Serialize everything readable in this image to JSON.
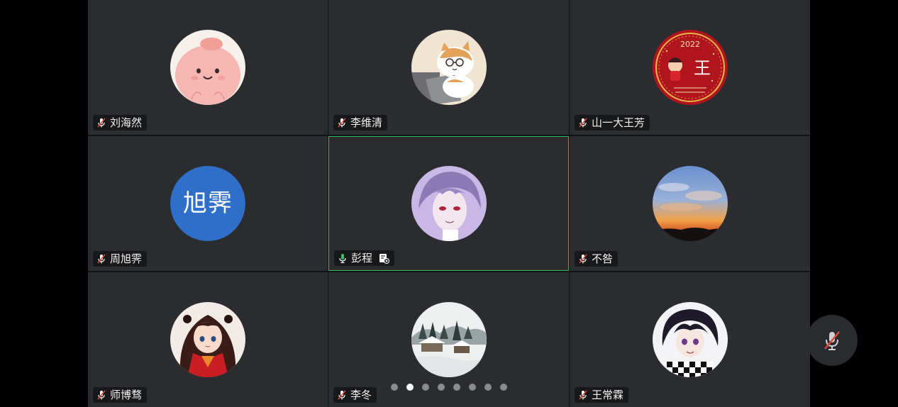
{
  "participants": [
    {
      "name": "刘海然",
      "mic": "muted",
      "avatar": "pink-blob-avatar"
    },
    {
      "name": "李维清",
      "mic": "muted",
      "avatar": "cat-with-glasses-avatar"
    },
    {
      "name": "山一大王芳",
      "mic": "muted",
      "avatar": "red-2022-badge-avatar",
      "avatar_text": "2022",
      "avatar_glyph": "王"
    },
    {
      "name": "周旭霁",
      "mic": "muted",
      "avatar": "text-avatar",
      "avatar_text": "旭霁",
      "avatar_color": "#2f6fc9"
    },
    {
      "name": "彭程",
      "mic": "active",
      "active": true,
      "host": true,
      "avatar": "anime-boy-purple-avatar"
    },
    {
      "name": "不咎",
      "mic": "muted",
      "avatar": "sunset-sky-avatar"
    },
    {
      "name": "师博骛",
      "mic": "muted",
      "avatar": "anime-girl-red-avatar"
    },
    {
      "name": "李冬",
      "mic": "muted",
      "avatar": "snow-landscape-avatar"
    },
    {
      "name": "王常霖",
      "mic": "muted",
      "avatar": "anime-boy-checkered-avatar"
    }
  ],
  "pagination": {
    "total": 8,
    "current": 2
  },
  "colors": {
    "tile_bg": "#2b2c2f",
    "active_border": "#2fbf5e",
    "muted_red": "#e0453a",
    "mic_green": "#35c16a",
    "text_avatar_blue": "#2f6fc9"
  },
  "mic_button": {
    "state": "muted",
    "icon": "mic-off-icon"
  }
}
